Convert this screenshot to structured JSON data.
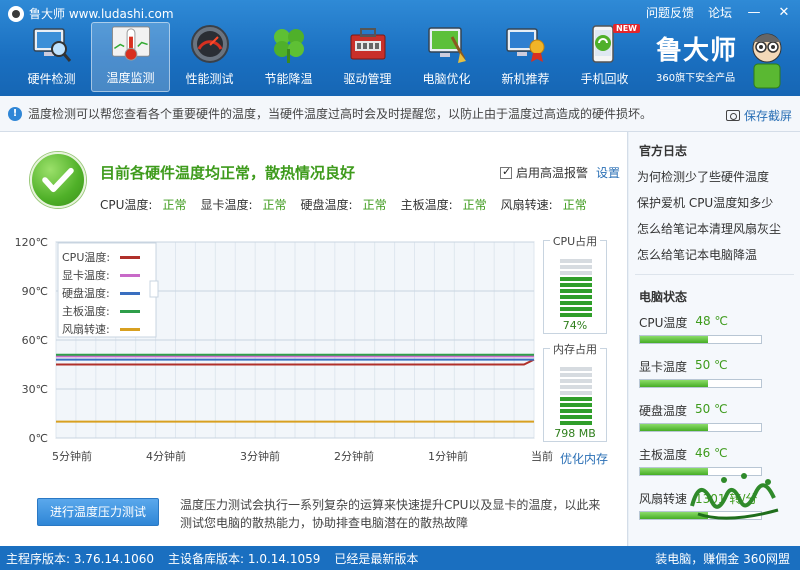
{
  "window": {
    "title": "鲁大师 www.ludashi.com",
    "links": [
      "问题反馈",
      "论坛"
    ],
    "min_label": "—",
    "close_label": "✕"
  },
  "nav": {
    "items": [
      {
        "label": "硬件检测",
        "icon": "monitor-magnifier-icon",
        "active": false
      },
      {
        "label": "温度监测",
        "icon": "thermometer-icon",
        "active": true
      },
      {
        "label": "性能测试",
        "icon": "speedometer-icon",
        "active": false
      },
      {
        "label": "节能降温",
        "icon": "clover-icon",
        "active": false
      },
      {
        "label": "驱动管理",
        "icon": "toolbox-icon",
        "active": false
      },
      {
        "label": "电脑优化",
        "icon": "screen-broom-icon",
        "active": false
      },
      {
        "label": "新机推荐",
        "icon": "monitor-medal-icon",
        "active": false
      },
      {
        "label": "手机回收",
        "icon": "phone-recycle-icon",
        "active": false,
        "badge": "NEW"
      }
    ]
  },
  "brand": {
    "name": "鲁大师",
    "tagline": "360旗下安全产品"
  },
  "info": {
    "text": "温度检测可以帮您查看各个重要硬件的温度，当硬件温度过高时会及时提醒您，以防止由于温度过高造成的硬件损坏。",
    "save_label": "保存截屏"
  },
  "status": {
    "headline": "目前各硬件温度均正常，散热情况良好",
    "alarm_label": "启用高温报警",
    "alarm_checked": true,
    "settings_label": "设置",
    "items": [
      {
        "label": "CPU温度:",
        "value": "正常"
      },
      {
        "label": "显卡温度:",
        "value": "正常"
      },
      {
        "label": "硬盘温度:",
        "value": "正常"
      },
      {
        "label": "主板温度:",
        "value": "正常"
      },
      {
        "label": "风扇转速:",
        "value": "正常"
      }
    ]
  },
  "chart_data": {
    "type": "line",
    "y_ticks": [
      "120℃",
      "90℃",
      "60℃",
      "30℃",
      "0℃"
    ],
    "ylim": [
      0,
      120
    ],
    "x_ticks": [
      "5分钟前",
      "4分钟前",
      "3分钟前",
      "2分钟前",
      "1分钟前",
      "当前"
    ],
    "legend": [
      {
        "name": "CPU温度:",
        "color": "#b0302a"
      },
      {
        "name": "显卡温度:",
        "color": "#c86ac8"
      },
      {
        "name": "硬盘温度:",
        "color": "#3a6fc0"
      },
      {
        "name": "主板温度:",
        "color": "#2f9e4a"
      },
      {
        "name": "风扇转速:",
        "color": "#d8a020"
      }
    ],
    "series": [
      {
        "name": "CPU温度:",
        "color": "#b0302a",
        "values": [
          45,
          45,
          45,
          45,
          45,
          48
        ]
      },
      {
        "name": "显卡温度:",
        "color": "#c86ac8",
        "values": [
          50,
          50,
          50,
          50,
          50,
          50
        ]
      },
      {
        "name": "硬盘温度:",
        "color": "#3a6fc0",
        "values": [
          48,
          48,
          48,
          48,
          48,
          48
        ]
      },
      {
        "name": "主板温度:",
        "color": "#2f9e4a",
        "values": [
          51,
          51,
          51,
          51,
          51,
          51
        ]
      },
      {
        "name": "风扇转速:",
        "color": "#d8a020",
        "values": [
          10,
          10,
          10,
          10,
          10,
          10
        ]
      }
    ]
  },
  "gauges": {
    "cpu": {
      "title": "CPU占用",
      "value": "74%",
      "level": 0.74
    },
    "mem": {
      "title": "内存占用",
      "value": "798 MB",
      "level": 0.5
    }
  },
  "optimize_label": "优化内存",
  "stress": {
    "button_label": "进行温度压力测试",
    "desc_line1": "温度压力测试会执行一系列复杂的运算来快速提升CPU以及显卡的温度，以此来",
    "desc_line2": "测试您电脑的散热能力，协助排查电脑潜在的散热故障"
  },
  "sidebar": {
    "log_title": "官方日志",
    "logs": [
      "为何检测少了些硬件温度",
      "保护爱机 CPU温度知多少",
      "怎么给笔记本清理风扇灰尘",
      "怎么给笔记本电脑降温"
    ],
    "pc_title": "电脑状态",
    "temps": [
      {
        "label": "CPU温度",
        "value": "48 ℃",
        "level": 0.56
      },
      {
        "label": "显卡温度",
        "value": "50 ℃",
        "level": 0.56
      },
      {
        "label": "硬盘温度",
        "value": "50 ℃",
        "level": 0.56
      },
      {
        "label": "主板温度",
        "value": "46 ℃",
        "level": 0.56
      },
      {
        "label": "风扇转速",
        "value": "1301 转/分",
        "level": 0.56
      }
    ]
  },
  "statusbar": {
    "main_version": "主程序版本: 3.76.14.1060",
    "db_version": "主设备库版本: 1.0.14.1059",
    "update_status": "已经是最新版本",
    "right_text": "装电脑，赚佣金 360网盟"
  },
  "colors": {
    "accent": "#1a6fc0",
    "ok_green": "#3e9b1c",
    "link": "#2a6fb5"
  }
}
